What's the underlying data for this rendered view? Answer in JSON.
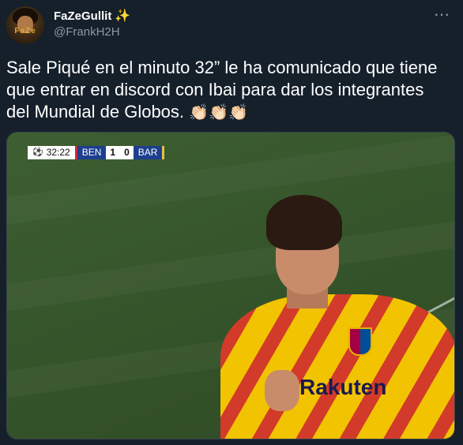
{
  "author": {
    "display_name": "FaZeGullit",
    "name_emoji": "✨",
    "handle": "@FrankH2H",
    "avatar_text": "FaZe"
  },
  "more_icon": "⋯",
  "tweet": {
    "text": "Sale Piqué en el minuto 32” le ha comunicado que tiene que entrar en discord con Ibai para dar los integrantes del Mundial de Globos.",
    "emojis": "👏🏻👏🏻👏🏻"
  },
  "media": {
    "scoreboard": {
      "clock": "32:22",
      "home_team": "BEN",
      "home_score": "1",
      "away_score": "0",
      "away_team": "BAR"
    },
    "sponsor": "Rakuten"
  },
  "colors": {
    "background": "#15202b",
    "secondary_text": "#8b98a5",
    "pitch": "#3e5f32"
  }
}
